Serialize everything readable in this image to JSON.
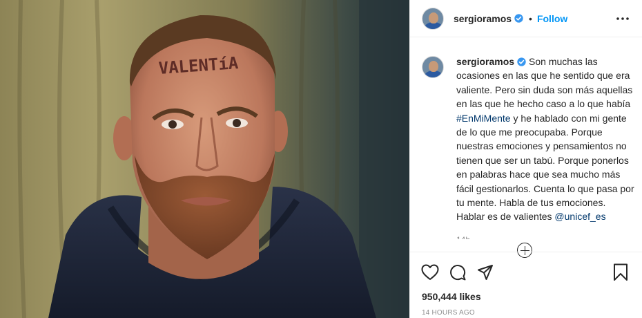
{
  "post": {
    "photo_text": "VALENTíA",
    "header": {
      "username": "sergioramos",
      "separator": "•",
      "follow_label": "Follow"
    },
    "caption": {
      "username": "sergioramos",
      "text_part1": "Son muchas las ocasiones en las que he sentido que era valiente. Pero sin duda son más aquellas en las que he hecho caso a lo que había",
      "hashtag": "#EnMiMente",
      "text_part2": "y he hablado con mi gente de lo que me preocupaba. Porque nuestras emociones y pensamientos no tienen que ser un tabú. Porque ponerlos en palabras hace que sea mucho más fácil gestionarlos. Cuenta lo que pasa por tu mente. Habla de tus emociones. Hablar es de valientes",
      "mention": "@unicef_es",
      "time": "14h"
    },
    "likes": "950,444 likes",
    "time_ago": "14 HOURS AGO",
    "colors": {
      "link_blue": "#0095f6",
      "mention_blue": "#00376b",
      "muted_gray": "#8e8e8e"
    },
    "icons": [
      "verified-badge-icon",
      "more-options-icon",
      "load-more-icon",
      "heart-icon",
      "comment-icon",
      "share-icon",
      "bookmark-icon"
    ]
  }
}
